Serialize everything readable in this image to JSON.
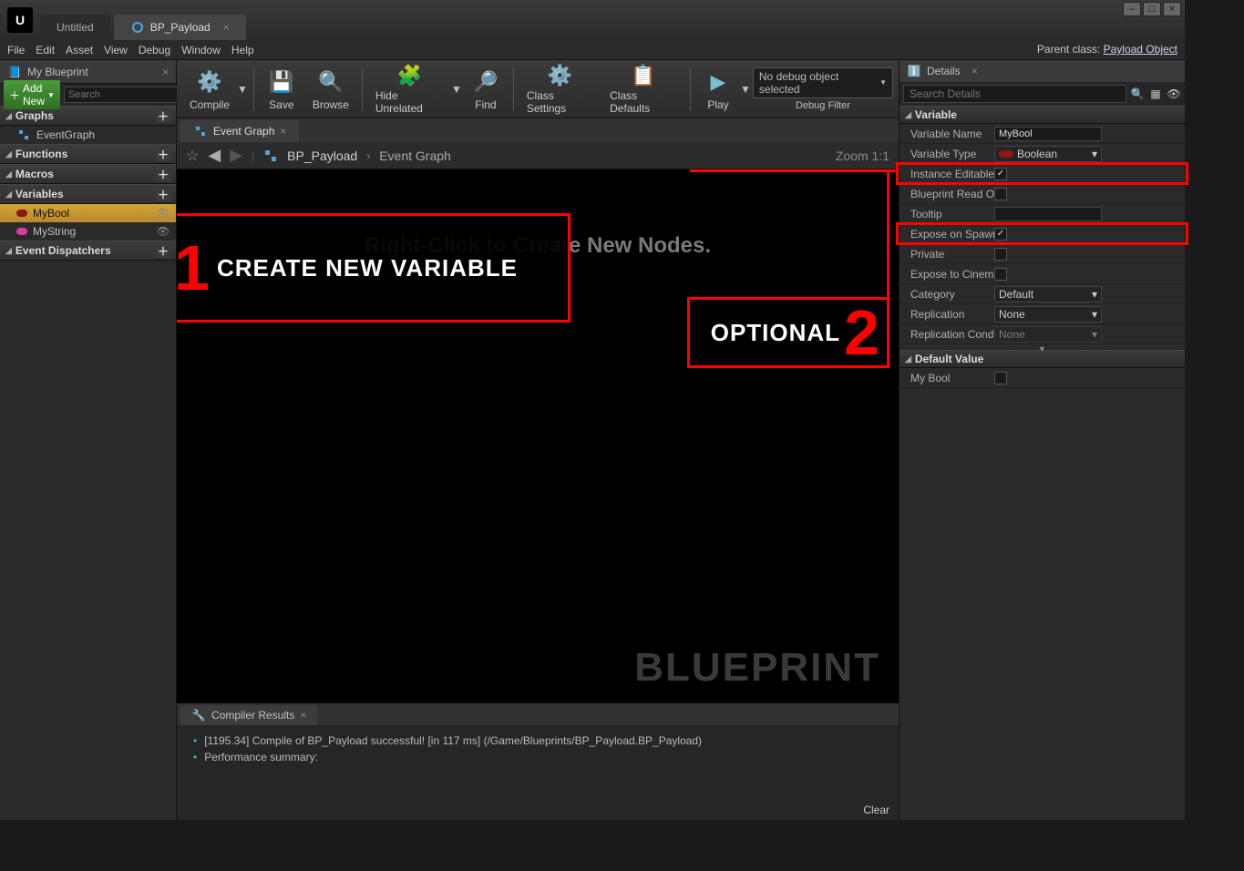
{
  "window": {
    "tabs": [
      {
        "label": "Untitled",
        "active": false
      },
      {
        "label": "BP_Payload",
        "active": true
      }
    ]
  },
  "menubar": [
    "File",
    "Edit",
    "Asset",
    "View",
    "Debug",
    "Window",
    "Help"
  ],
  "parent_class": {
    "prefix": "Parent class:",
    "name": "Payload Object"
  },
  "left": {
    "tab_title": "My Blueprint",
    "add_new": "Add New",
    "search_placeholder": "Search",
    "sections": {
      "graphs": "Graphs",
      "eventgraph": "EventGraph",
      "functions": "Functions",
      "macros": "Macros",
      "variables": "Variables",
      "event_dispatchers": "Event Dispatchers"
    },
    "vars": [
      {
        "name": "MyBool",
        "selected": true,
        "color": "red"
      },
      {
        "name": "MyString",
        "selected": false,
        "color": "pink"
      }
    ]
  },
  "toolbar": {
    "compile": "Compile",
    "save": "Save",
    "browse": "Browse",
    "hide": "Hide Unrelated",
    "find": "Find",
    "class_settings": "Class Settings",
    "class_defaults": "Class Defaults",
    "play": "Play",
    "debug_select": "No debug object selected",
    "debug_filter": "Debug Filter"
  },
  "graph": {
    "tab": "Event Graph",
    "crumb_root": "BP_Payload",
    "crumb_leaf": "Event Graph",
    "zoom": "Zoom 1:1",
    "hint": "Right-Click to Create New Nodes.",
    "watermark": "BLUEPRINT"
  },
  "annotations": {
    "one_text": "CREATE NEW VARIABLE",
    "two_text": "OPTIONAL"
  },
  "compiler": {
    "tab": "Compiler Results",
    "line1": "[1195.34] Compile of BP_Payload successful! [in 117 ms] (/Game/Blueprints/BP_Payload.BP_Payload)",
    "line2": "Performance summary:",
    "clear": "Clear"
  },
  "details": {
    "tab": "Details",
    "search_placeholder": "Search Details",
    "categories": {
      "variable": "Variable",
      "default_value": "Default Value"
    },
    "rows": {
      "var_name_label": "Variable Name",
      "var_name_value": "MyBool",
      "var_type_label": "Variable Type",
      "var_type_value": "Boolean",
      "instance_editable": "Instance Editable",
      "bp_readonly": "Blueprint Read Onl",
      "tooltip": "Tooltip",
      "expose_spawn": "Expose on Spawn",
      "private": "Private",
      "expose_cinematic": "Expose to Cinemat",
      "category_label": "Category",
      "category_value": "Default",
      "replication_label": "Replication",
      "replication_value": "None",
      "rep_cond_label": "Replication Conditi",
      "rep_cond_value": "None",
      "my_bool_label": "My Bool"
    }
  }
}
